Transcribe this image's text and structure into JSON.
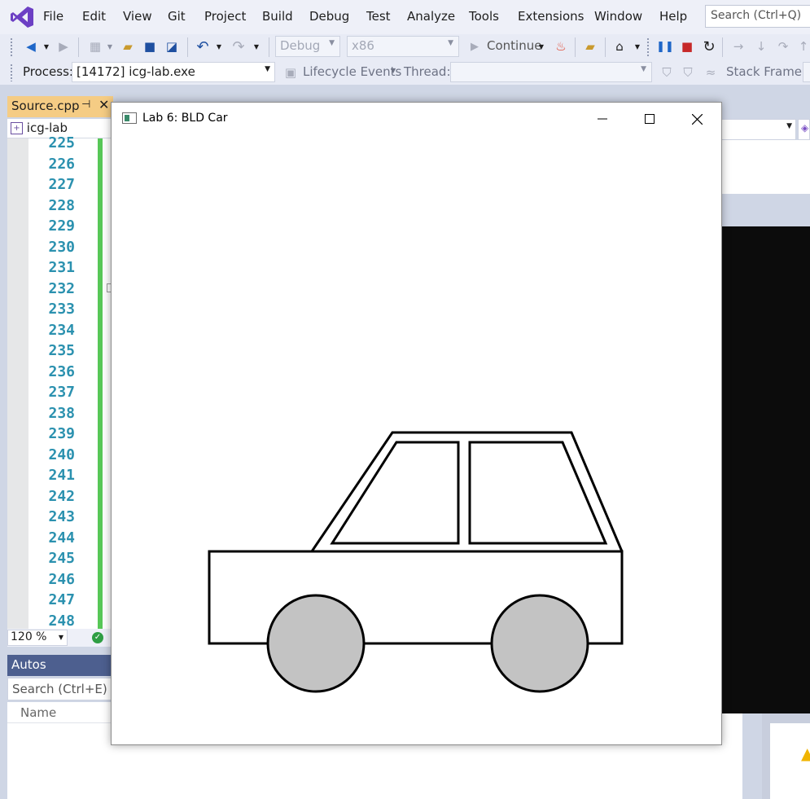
{
  "menu": {
    "items": [
      "File",
      "Edit",
      "View",
      "Git",
      "Project",
      "Build",
      "Debug",
      "Test",
      "Analyze",
      "Tools",
      "Extensions",
      "Window",
      "Help"
    ],
    "search_placeholder": "Search (Ctrl+Q)"
  },
  "toolbar": {
    "config": "Debug",
    "platform": "x86",
    "continue_label": "Continue"
  },
  "debug_location": {
    "process_label": "Process:",
    "process_value": "[14172] icg-lab.exe",
    "lifecycle_label": "Lifecycle Events",
    "thread_label": "Thread:",
    "stack_frame_label": "Stack Frame:"
  },
  "editor": {
    "tab_name": "Source.cpp",
    "project": "icg-lab",
    "line_numbers": [
      "225",
      "226",
      "227",
      "228",
      "229",
      "230",
      "231",
      "232",
      "233",
      "234",
      "235",
      "236",
      "237",
      "238",
      "239",
      "240",
      "241",
      "242",
      "243",
      "244",
      "245",
      "246",
      "247",
      "248"
    ],
    "zoom": "120 %"
  },
  "autos": {
    "title": "Autos",
    "search_placeholder": "Search (Ctrl+E)",
    "column_name": "Name"
  },
  "app_window": {
    "title": "Lab 6: BLD Car"
  },
  "colors": {
    "menu_bg": "#eef0f8",
    "tab_active": "#f5cc84",
    "change_bar": "#57c757",
    "line_number": "#2b91af",
    "wheel_fill": "#c3c3c3",
    "autos_header": "#4d5f8f"
  }
}
